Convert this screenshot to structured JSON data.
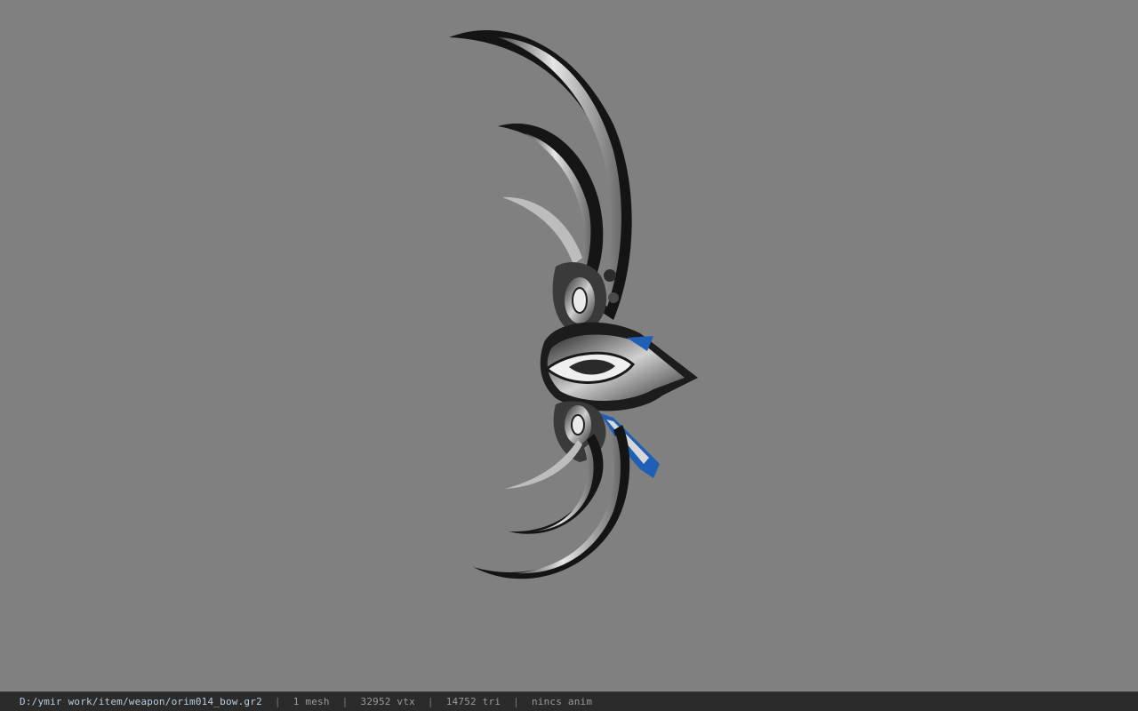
{
  "viewer": {
    "background_color": "#808080",
    "model_name": "orim014_bow",
    "model_colors": {
      "blade_dark": "#151515",
      "blade_silver": "#c9c9c9",
      "accent_blue": "#1f5fb5"
    }
  },
  "status_bar": {
    "file_path": "D:/ymir work/item/weapon/orim014_bow.gr2",
    "separator": "|",
    "mesh_count": "1 mesh",
    "vertex_count": "32952 vtx",
    "triangle_count": "14752 tri",
    "anim_status": "nincs anim"
  }
}
